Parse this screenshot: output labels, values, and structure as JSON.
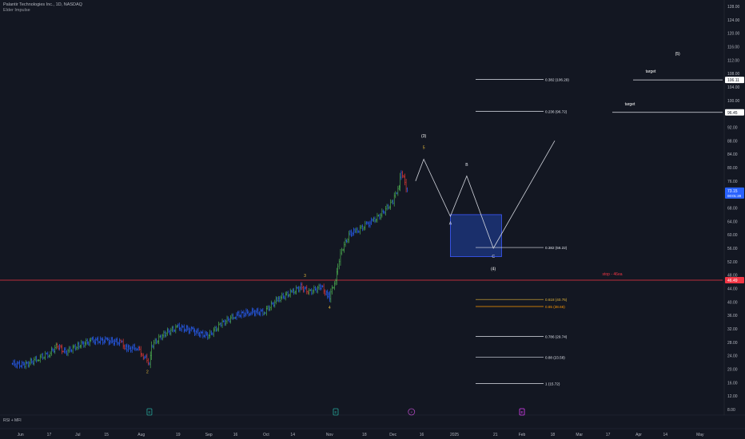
{
  "header": {
    "symbol_line": "Palantir Technologies Inc., 1D, NASDAQ",
    "indicator": "Elder Impulse"
  },
  "bottom_pane": {
    "label": "RSI + MFI"
  },
  "colors": {
    "background": "#131722",
    "bull": "#4caf50",
    "bear": "#e53935",
    "neutral": "#2962ff",
    "projection": "#d1d4dc",
    "stop_line": "#f23645",
    "fib_white": "#e0e3eb",
    "fib_gold": "#e5b73b",
    "fib_orange": "#ff9800",
    "box_fill": "#1e3a8a",
    "box_border": "#3d5afe",
    "last_price_bg": "#2962ff",
    "earnings_green": "#26a69a",
    "event_purple": "#ab47bc",
    "dividend_magenta": "#e040fb"
  },
  "chart_data": {
    "type": "line",
    "title": "Palantir Technologies Inc., 1D, NASDAQ",
    "series": [
      {
        "name": "",
        "points": [
          {
            "x": "2024-05-30",
            "y": 21.6
          },
          {
            "x": "2024-06-05",
            "y": 21.2
          },
          {
            "x": "2024-06-12",
            "y": 23.3
          },
          {
            "x": "2024-06-17",
            "y": 24.6
          },
          {
            "x": "2024-06-21",
            "y": 27.0
          },
          {
            "x": "2024-06-25",
            "y": 25.0
          },
          {
            "x": "2024-07-01",
            "y": 27.0
          },
          {
            "x": "2024-07-08",
            "y": 28.5
          },
          {
            "x": "2024-07-15",
            "y": 28.5
          },
          {
            "x": "2024-07-22",
            "y": 28.0
          },
          {
            "x": "2024-07-25",
            "y": 26.0
          },
          {
            "x": "2024-07-30",
            "y": 26.5
          },
          {
            "x": "2024-08-02",
            "y": 24.0
          },
          {
            "x": "2024-08-05",
            "y": 22.0
          },
          {
            "x": "2024-08-06",
            "y": 27.0
          },
          {
            "x": "2024-08-12",
            "y": 30.5
          },
          {
            "x": "2024-08-19",
            "y": 32.5
          },
          {
            "x": "2024-08-26",
            "y": 31.5
          },
          {
            "x": "2024-08-30",
            "y": 30.5
          },
          {
            "x": "2024-09-03",
            "y": 30.0
          },
          {
            "x": "2024-09-09",
            "y": 33.5
          },
          {
            "x": "2024-09-16",
            "y": 36.0
          },
          {
            "x": "2024-09-23",
            "y": 37.0
          },
          {
            "x": "2024-09-30",
            "y": 37.0
          },
          {
            "x": "2024-10-07",
            "y": 41.0
          },
          {
            "x": "2024-10-14",
            "y": 43.0
          },
          {
            "x": "2024-10-18",
            "y": 44.5
          },
          {
            "x": "2024-10-22",
            "y": 43.0
          },
          {
            "x": "2024-10-28",
            "y": 44.5
          },
          {
            "x": "2024-10-31",
            "y": 42.0
          },
          {
            "x": "2024-11-01",
            "y": 41.5
          },
          {
            "x": "2024-11-04",
            "y": 47.0
          },
          {
            "x": "2024-11-05",
            "y": 51.0
          },
          {
            "x": "2024-11-07",
            "y": 55.5
          },
          {
            "x": "2024-11-11",
            "y": 60.5
          },
          {
            "x": "2024-11-14",
            "y": 61.0
          },
          {
            "x": "2024-11-19",
            "y": 63.0
          },
          {
            "x": "2024-11-22",
            "y": 64.0
          },
          {
            "x": "2024-11-26",
            "y": 66.0
          },
          {
            "x": "2024-12-02",
            "y": 70.0
          },
          {
            "x": "2024-12-05",
            "y": 75.0
          },
          {
            "x": "2024-12-06",
            "y": 79.0
          },
          {
            "x": "2024-12-09",
            "y": 73.15
          }
        ]
      }
    ],
    "projection_path": [
      {
        "x": "2024-12-13",
        "y": 76.0
      },
      {
        "x": "2024-12-17",
        "y": 82.5
      },
      {
        "x": "2024-12-30",
        "y": 65.5
      },
      {
        "x": "2025-01-07",
        "y": 77.5
      },
      {
        "x": "2025-01-20",
        "y": 56.0
      },
      {
        "x": "2025-02-19",
        "y": 88.0
      }
    ],
    "wave_labels": [
      {
        "text": "2",
        "x": "2024-08-04",
        "y": 18.8,
        "color": "#e5b73b"
      },
      {
        "text": "3",
        "x": "2024-10-20",
        "y": 47.5,
        "color": "#e5b73b"
      },
      {
        "text": "4",
        "x": "2024-11-01",
        "y": 38.0,
        "color": "#e5b73b"
      },
      {
        "text": "5",
        "x": "2024-12-17",
        "y": 85.6,
        "color": "#e5b73b"
      },
      {
        "text": "(3)",
        "x": "2024-12-17",
        "y": 89.0,
        "color": "#ffffff"
      },
      {
        "text": "A",
        "x": "2024-12-30",
        "y": 63.0,
        "color": "#e0e3eb"
      },
      {
        "text": "B",
        "x": "2025-01-07",
        "y": 80.5,
        "color": "#e0e3eb"
      },
      {
        "text": "C",
        "x": "2025-01-20",
        "y": 53.2,
        "color": "#e0e3eb"
      },
      {
        "text": "(4)",
        "x": "2025-01-20",
        "y": 49.5,
        "color": "#ffffff"
      },
      {
        "text": "(5)",
        "x": "2025-04-20",
        "y": 113.5,
        "color": "#ffffff"
      }
    ],
    "fib_levels": [
      {
        "ratio": "0.382",
        "price": 106.29,
        "label": "0.382 (106.29)",
        "color": "#e0e3eb"
      },
      {
        "ratio": "0.236",
        "price": 96.72,
        "label": "0.236 (96.72)",
        "color": "#e0e3eb"
      },
      {
        "ratio": "0.382",
        "price": 56.22,
        "label": "0.382 (56.22)",
        "color": "#e0e3eb"
      },
      {
        "ratio": "0.618",
        "price": 40.75,
        "label": "0.618 (40.75)",
        "color": "#e5b73b"
      },
      {
        "ratio": "0.65",
        "price": 38.66,
        "label": "0.65 (38.66)",
        "color": "#ff9800"
      },
      {
        "ratio": "0.786",
        "price": 29.74,
        "label": "0.786 (29.74)",
        "color": "#e0e3eb"
      },
      {
        "ratio": "0.88",
        "price": 23.58,
        "label": "0.88 (23.58)",
        "color": "#e0e3eb"
      },
      {
        "ratio": "1",
        "price": 15.72,
        "label": "1 (15.72)",
        "color": "#e0e3eb"
      }
    ],
    "targets": [
      {
        "label": "target",
        "price": 106.11
      },
      {
        "label": "target",
        "price": 96.45
      }
    ],
    "zone": {
      "from": "2024-12-30",
      "to": "2025-01-24",
      "y_top": 66.0,
      "y_bottom": 53.5
    },
    "stop": {
      "label": "stop - 46ea",
      "price": 46.49
    },
    "axis_price_labels": [
      {
        "text": "106.11",
        "price": 106.11,
        "style": "white"
      },
      {
        "text": "96.45",
        "price": 96.45,
        "style": "white"
      },
      {
        "text": "73.15",
        "sub": "00:01:28",
        "price": 73.15,
        "style": "blue"
      },
      {
        "text": "46.49",
        "price": 46.49,
        "style": "red"
      }
    ],
    "y_ticks": [
      "128.00",
      "124.00",
      "120.00",
      "116.00",
      "112.00",
      "108.00",
      "104.00",
      "100.00",
      "96.00",
      "92.00",
      "88.00",
      "84.00",
      "80.00",
      "76.00",
      "72.00",
      "68.00",
      "64.00",
      "60.00",
      "56.00",
      "52.00",
      "48.00",
      "44.00",
      "40.00",
      "36.00",
      "32.00",
      "28.00",
      "24.00",
      "20.00",
      "16.00",
      "12.00",
      "8.00"
    ],
    "x_ticks": [
      {
        "label": "Jun",
        "x": "2024-06-03"
      },
      {
        "label": "17",
        "x": "2024-06-17"
      },
      {
        "label": "Jul",
        "x": "2024-07-01"
      },
      {
        "label": "15",
        "x": "2024-07-15"
      },
      {
        "label": "Aug",
        "x": "2024-08-01"
      },
      {
        "label": "19",
        "x": "2024-08-19"
      },
      {
        "label": "Sep",
        "x": "2024-09-03"
      },
      {
        "label": "16",
        "x": "2024-09-16"
      },
      {
        "label": "Oct",
        "x": "2024-10-01"
      },
      {
        "label": "14",
        "x": "2024-10-14"
      },
      {
        "label": "Nov",
        "x": "2024-11-01"
      },
      {
        "label": "18",
        "x": "2024-11-18"
      },
      {
        "label": "Dec",
        "x": "2024-12-02"
      },
      {
        "label": "16",
        "x": "2024-12-16"
      },
      {
        "label": "2025",
        "x": "2025-01-01"
      },
      {
        "label": "21",
        "x": "2025-01-21"
      },
      {
        "label": "Feb",
        "x": "2025-02-03"
      },
      {
        "label": "18",
        "x": "2025-02-18"
      },
      {
        "label": "Mar",
        "x": "2025-03-03"
      },
      {
        "label": "17",
        "x": "2025-03-17"
      },
      {
        "label": "Apr",
        "x": "2025-04-01"
      },
      {
        "label": "14",
        "x": "2025-04-14"
      },
      {
        "label": "May",
        "x": "2025-05-01"
      }
    ],
    "events": [
      {
        "x": "2024-08-05",
        "glyph": "E",
        "type": "earnings"
      },
      {
        "x": "2024-11-04",
        "glyph": "E",
        "type": "earnings"
      },
      {
        "x": "2024-12-11",
        "glyph": "⚡",
        "type": "event"
      },
      {
        "x": "2025-02-03",
        "glyph": "E",
        "type": "dividend"
      }
    ],
    "ylim": [
      8,
      128
    ],
    "grid": false,
    "legend": "none"
  }
}
